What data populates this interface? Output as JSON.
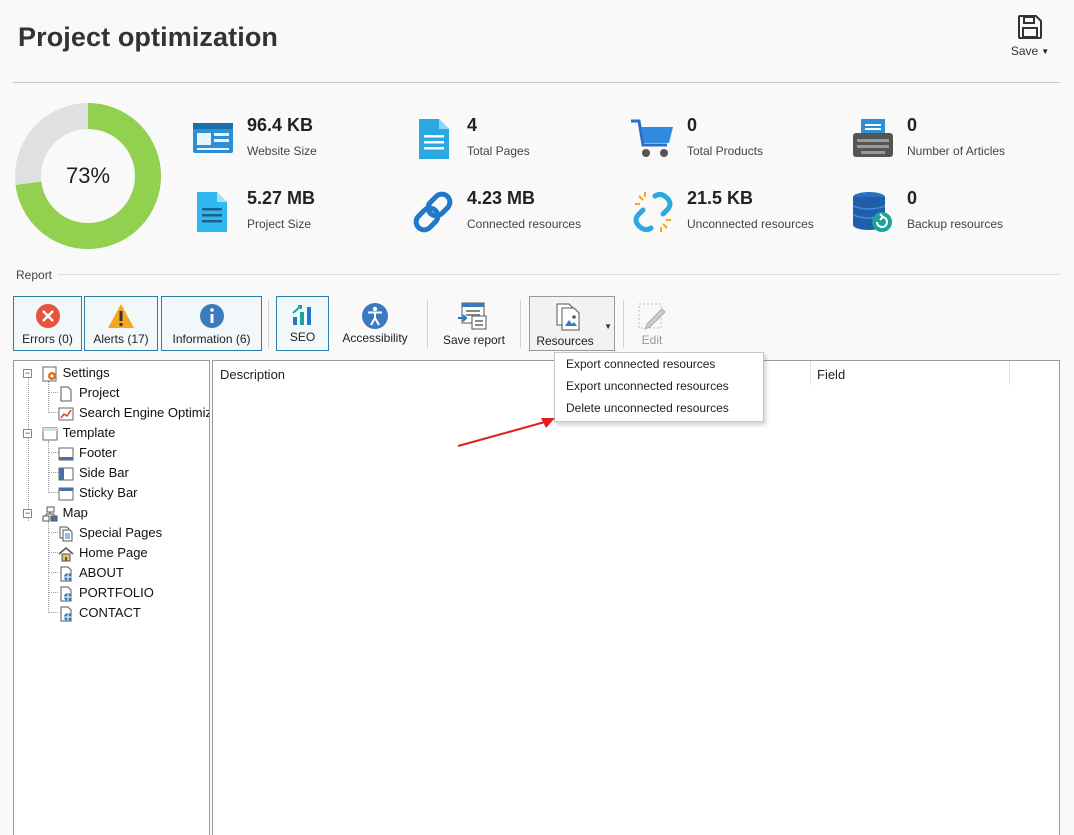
{
  "header": {
    "title": "Project optimization",
    "save_label": "Save"
  },
  "progress": {
    "percent": 0.73,
    "label": "73%",
    "filled_color": "#92d050",
    "empty_color": "#e0e0e0"
  },
  "stats": [
    {
      "value": "96.4 KB",
      "label": "Website Size",
      "icon": "website-icon"
    },
    {
      "value": "4",
      "label": "Total Pages",
      "icon": "pages-icon"
    },
    {
      "value": "0",
      "label": "Total Products",
      "icon": "cart-icon"
    },
    {
      "value": "0",
      "label": "Number of Articles",
      "icon": "typewriter-icon"
    },
    {
      "value": "5.27 MB",
      "label": "Project Size",
      "icon": "document-icon"
    },
    {
      "value": "4.23 MB",
      "label": "Connected resources",
      "icon": "link-icon"
    },
    {
      "value": "21.5 KB",
      "label": "Unconnected resources",
      "icon": "broken-link-icon"
    },
    {
      "value": "0",
      "label": "Backup resources",
      "icon": "database-backup-icon"
    }
  ],
  "report": {
    "label": "Report",
    "toolbar": {
      "errors": "Errors (0)",
      "alerts": "Alerts (17)",
      "information": "Information (6)",
      "seo": "SEO",
      "accessibility": "Accessibility",
      "save_report": "Save report",
      "resources": "Resources",
      "edit": "Edit"
    }
  },
  "resources_menu": {
    "items": [
      "Export connected resources",
      "Export unconnected resources",
      "Delete unconnected resources"
    ]
  },
  "tree": {
    "settings": "Settings",
    "project": "Project",
    "seo": "Search Engine Optimization",
    "template": "Template",
    "footer": "Footer",
    "side_bar": "Side Bar",
    "sticky_bar": "Sticky Bar",
    "map": "Map",
    "special_pages": "Special Pages",
    "home_page": "Home Page",
    "about": "ABOUT",
    "portfolio": "PORTFOLIO",
    "contact": "CONTACT"
  },
  "grid": {
    "columns": [
      "Description",
      "Field"
    ]
  },
  "colors": {
    "accent": "#2c7fa8",
    "error": "#e5533d",
    "alert": "#f5a623",
    "info": "#3a7bbf",
    "arrow": "#e02020"
  }
}
